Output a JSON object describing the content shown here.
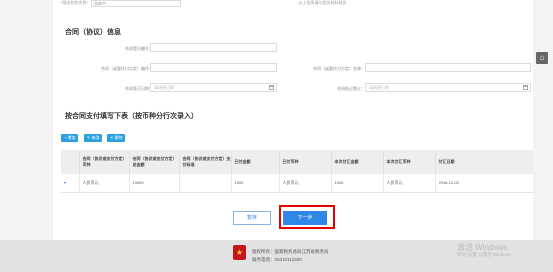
{
  "top_partial": {
    "label_required": "*",
    "label": "基金机构名称：",
    "value": "浙商中",
    "right_text": "· 以上信息请与相关材料核实 ·"
  },
  "contract_section": {
    "title": "合同（协议）信息",
    "fields": {
      "contract_no_label": "合同登记编号：",
      "party_no_label": "合同（或委托付方定）编号：",
      "party_name_label": "合同（或委托付方定）名称：",
      "sign_date_label": "合同签订日期：",
      "sign_date_placeholder": "请选择日期",
      "end_date_label": "合同结订期止：",
      "end_date_placeholder": "请选择日期"
    }
  },
  "schedule_section": {
    "title": "按合同支付填写下表（按币种分行次录入）",
    "toolbar": {
      "add_label": "+ 增加",
      "edit_label": "✎ 修改",
      "delete_label": "✕ 删除"
    },
    "columns": [
      "",
      "合同（协议或支付方定）币种",
      "合同（协议或支付方定）总金额",
      "合同（协议或支付方定）支付标准",
      "已付金额",
      "已付币种",
      "本次付汇金额",
      "本次付汇币种",
      "付汇日期"
    ],
    "rows": [
      {
        "selector": "▾",
        "currency": "人民币元",
        "total": "10000",
        "standard": "",
        "paid_amount": "1000",
        "paid_currency": "人民币元",
        "this_amount": "1000",
        "this_currency": "人民币元",
        "date": "2016-12-02"
      }
    ]
  },
  "actions": {
    "save_label": "暂存",
    "next_label": "下一步"
  },
  "side_button_label": "⌂",
  "footer": {
    "emblem": "★",
    "line1": "版权所有：国家税务总局江苏省税务局",
    "line2": "服务电话：00310112300"
  },
  "watermark": {
    "line1": "激活 Windows",
    "line2": "转到\"设置\"以激活 Windows。"
  }
}
